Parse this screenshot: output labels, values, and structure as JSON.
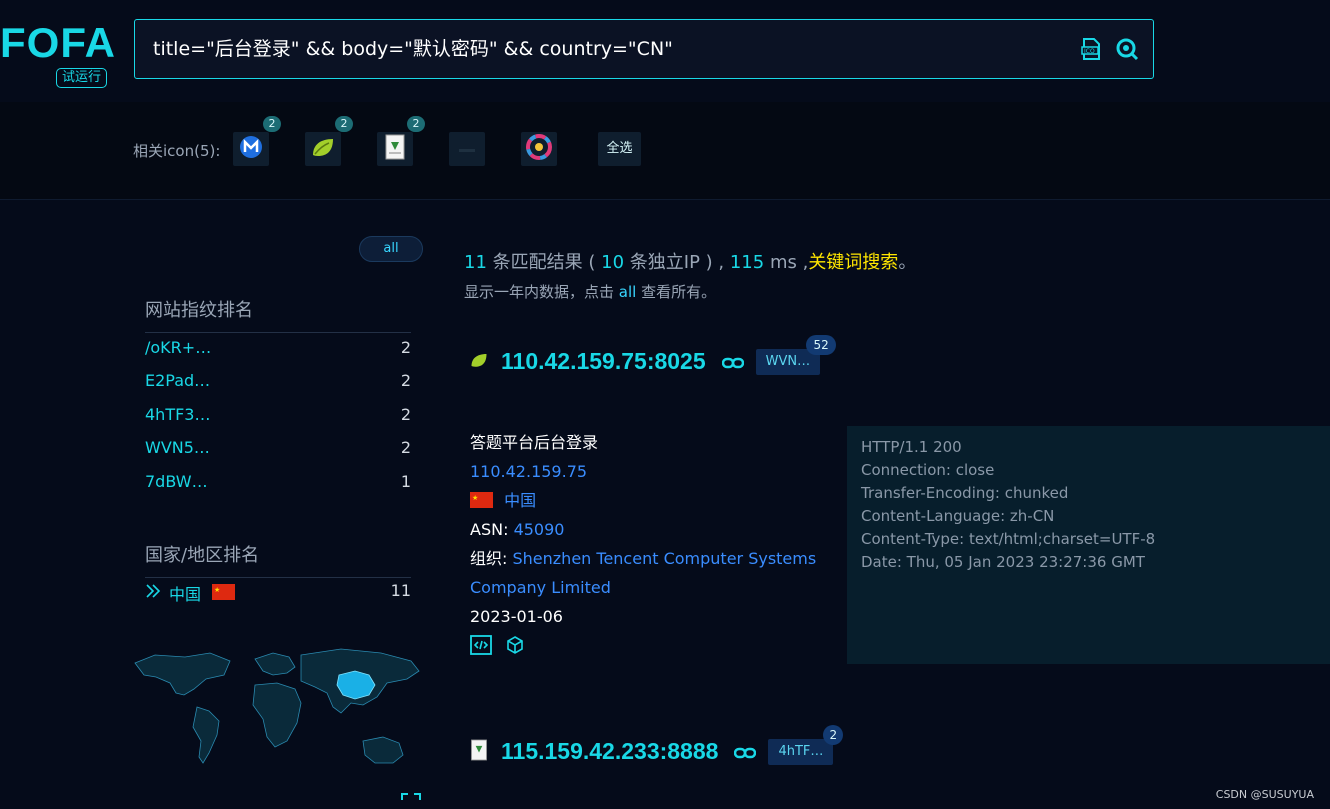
{
  "header": {
    "logo_text": "FOFA",
    "logo_badge": "试运行",
    "search_value": "title=\"后台登录\" && body=\"默认密码\" && country=\"CN\""
  },
  "iconbar": {
    "label": "相关icon(5):",
    "icons": [
      {
        "name": "m-logo-icon",
        "badge": "2"
      },
      {
        "name": "leaf-icon",
        "badge": "2"
      },
      {
        "name": "document-icon",
        "badge": "2"
      },
      {
        "name": "blank-icon",
        "badge": ""
      },
      {
        "name": "ring-logo-icon",
        "badge": ""
      }
    ],
    "select_all": "全选"
  },
  "sidebar": {
    "all_label": "all",
    "fingerprint_title": "网站指纹排名",
    "fingerprints": [
      {
        "name": "/oKR+…",
        "count": "2"
      },
      {
        "name": "E2Pad…",
        "count": "2"
      },
      {
        "name": "4hTF3…",
        "count": "2"
      },
      {
        "name": "WVN5…",
        "count": "2"
      },
      {
        "name": "7dBW…",
        "count": "1"
      }
    ],
    "country_title": "国家/地区排名",
    "country": {
      "name": "中国",
      "count": "11"
    }
  },
  "summary": {
    "matches": "11",
    "matches_text": "条匹配结果 (",
    "unique_ips": "10",
    "unique_text": "条独立IP ) ,",
    "ms": "115",
    "ms_text": "ms ,",
    "keyword_search": "关键词搜索",
    "period": "。",
    "subline_a": "显示一年内数据，点击",
    "subline_all": "all",
    "subline_b": "查看所有。"
  },
  "results": [
    {
      "ip_port": "110.42.159.75:8025",
      "tag": "WVN…",
      "tag_count": "52",
      "title": "答题平台后台登录",
      "ip": "110.42.159.75",
      "country": "中国",
      "asn_label": "ASN:",
      "asn": "45090",
      "org_label": "组织:",
      "org": "Shenzhen Tencent Computer Systems Company Limited",
      "date": "2023-01-06",
      "headers": [
        "HTTP/1.1 200",
        "Connection: close",
        "Transfer-Encoding: chunked",
        "Content-Language: zh-CN",
        "Content-Type: text/html;charset=UTF-8",
        "Date: Thu, 05 Jan 2023 23:27:36 GMT"
      ]
    },
    {
      "ip_port": "115.159.42.233:8888",
      "tag": "4hTF…",
      "tag_count": "2"
    }
  ],
  "watermark": "CSDN @SUSUYUA",
  "colors": {
    "accent": "#19d8e6",
    "keyword": "#ffe600",
    "link": "#3a8dff",
    "background": "#050b1a"
  }
}
